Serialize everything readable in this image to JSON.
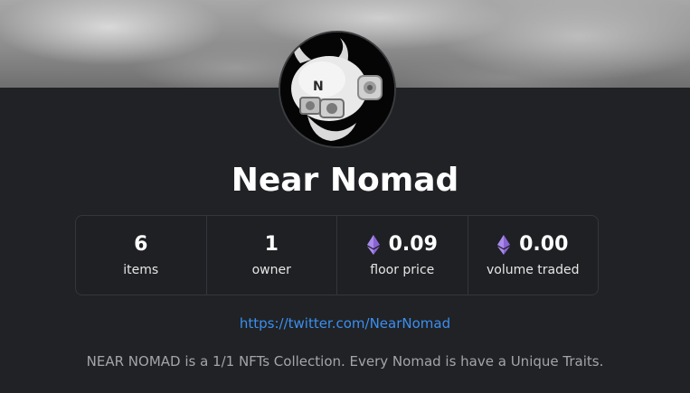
{
  "collection": {
    "name": "Near Nomad",
    "twitter_url": "https://twitter.com/NearNomad",
    "description": "NEAR NOMAD is a 1/1 NFTs Collection. Every Nomad is have a Unique Traits."
  },
  "stats": [
    {
      "value": "6",
      "label": "items",
      "icon": ""
    },
    {
      "value": "1",
      "label": "owner",
      "icon": ""
    },
    {
      "value": "0.09",
      "label": "floor price",
      "icon": "ethereum-icon"
    },
    {
      "value": "0.00",
      "label": "volume traded",
      "icon": "ethereum-icon"
    }
  ],
  "colors": {
    "background": "#202225",
    "link": "#3b8ff0",
    "eth_purple": "#8a63d2"
  }
}
